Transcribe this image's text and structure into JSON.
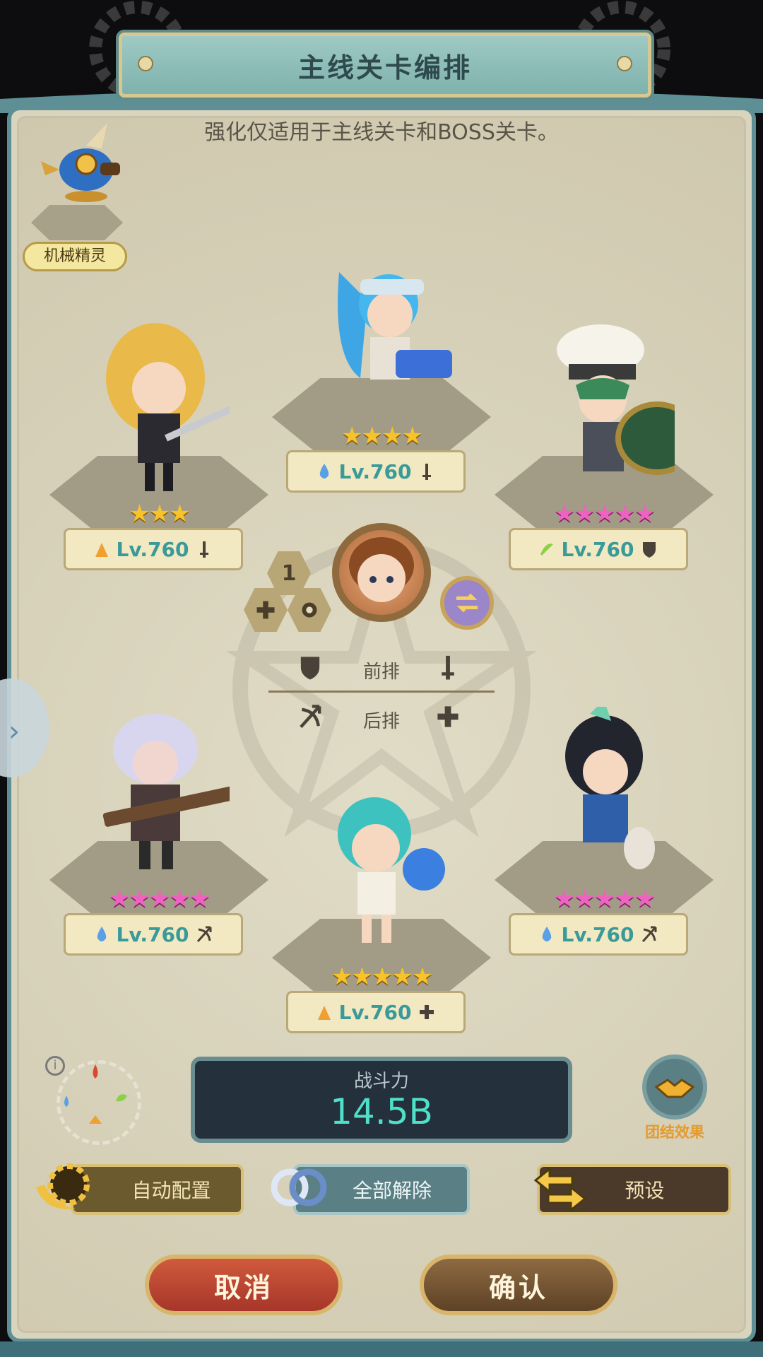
{
  "title": "主线关卡编排",
  "subtitle": "强化仅适用于主线关卡和BOSS关卡。",
  "spirit": {
    "label": "机械精灵"
  },
  "heroes": [
    {
      "slot": "front-left",
      "stars": "★★★",
      "star_color": "gold",
      "element": "fire",
      "level": "Lv.760",
      "role": "sword"
    },
    {
      "slot": "front-mid",
      "stars": "★★★★",
      "star_color": "gold",
      "element": "water",
      "level": "Lv.760",
      "role": "sword"
    },
    {
      "slot": "front-right",
      "stars": "★★★★★",
      "star_color": "pink",
      "element": "wind",
      "level": "Lv.760",
      "role": "shield"
    },
    {
      "slot": "back-left",
      "stars": "★★★★★",
      "star_color": "pink",
      "element": "water",
      "level": "Lv.760",
      "role": "bow"
    },
    {
      "slot": "back-mid",
      "stars": "★★★★★",
      "star_color": "gold",
      "element": "fire",
      "level": "Lv.760",
      "role": "healer"
    },
    {
      "slot": "back-right",
      "stars": "★★★★★",
      "star_color": "pink",
      "element": "water",
      "level": "Lv.760",
      "role": "bow"
    }
  ],
  "center": {
    "count": "1"
  },
  "rows": {
    "front": "前排",
    "back": "后排"
  },
  "power": {
    "label": "战斗力",
    "value": "14.5B"
  },
  "unity": {
    "label": "团结效果"
  },
  "buttons": {
    "auto": "自动配置",
    "clear": "全部解除",
    "preset": "预设",
    "cancel": "取消",
    "confirm": "确认"
  },
  "colors": {
    "fire": "#f0a030",
    "water": "#5aa0e6",
    "wind": "#8ccf4a",
    "accent": "#4fe0c9"
  }
}
